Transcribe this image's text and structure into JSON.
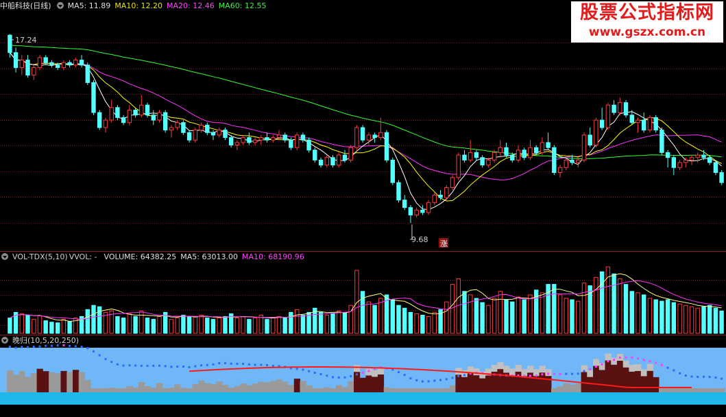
{
  "header": {
    "stock_name": "中船科技(日线)",
    "ma5_label": "MA5: 11.89",
    "ma10_label": "MA10: 12.20",
    "ma20_label": "MA20: 12.46",
    "ma60_label": "MA60: 12.55"
  },
  "annotations": {
    "high_label": "17.24",
    "low_label": "9.68",
    "rise_marker": "涨"
  },
  "volume_panel": {
    "indicator": "VOL-TDX(5,10)",
    "vvol": "VVOL: -",
    "volume_label": "VOLUME: 64382.25",
    "ma5_label": "MA5: 63013.00",
    "ma10_label": "MA10: 68190.96"
  },
  "indicator_panel": {
    "name": "晚归(10,5,20,250)"
  },
  "watermark": {
    "line1": "股票公式指标网",
    "line2": "www.gszx.com.cn"
  },
  "colors": {
    "up": "#ff3b3b",
    "down": "#54ffff",
    "ma5": "#ffffff",
    "ma10": "#ffff00",
    "ma20": "#ff33ff",
    "ma60": "#33ff33",
    "grid": "#8b1a1a",
    "indicator_bg": "#6fb7f7"
  },
  "chart_data": {
    "type": "candlestick",
    "price_range": [
      9.0,
      18.0
    ],
    "candles": [
      [
        17.2,
        17.24,
        16.3,
        16.5
      ],
      [
        16.5,
        16.7,
        15.7,
        15.9
      ],
      [
        15.9,
        16.4,
        15.6,
        16.2
      ],
      [
        16.2,
        16.4,
        15.5,
        15.6
      ],
      [
        15.6,
        16.0,
        15.4,
        15.9
      ],
      [
        15.9,
        16.4,
        15.8,
        16.3
      ],
      [
        16.3,
        16.4,
        16.0,
        16.1
      ],
      [
        16.1,
        16.2,
        15.9,
        16.0
      ],
      [
        16.0,
        16.1,
        15.8,
        15.9
      ],
      [
        15.9,
        16.2,
        15.8,
        16.1
      ],
      [
        16.1,
        16.2,
        15.9,
        16.0
      ],
      [
        16.0,
        16.3,
        15.9,
        16.2
      ],
      [
        16.2,
        16.4,
        15.9,
        16.0
      ],
      [
        16.0,
        16.1,
        15.2,
        15.3
      ],
      [
        15.3,
        15.4,
        14.0,
        14.1
      ],
      [
        14.1,
        14.2,
        13.4,
        13.5
      ],
      [
        13.5,
        13.9,
        13.3,
        13.8
      ],
      [
        13.8,
        14.6,
        13.7,
        14.3
      ],
      [
        14.3,
        14.4,
        13.8,
        13.9
      ],
      [
        13.9,
        14.0,
        13.6,
        13.7
      ],
      [
        13.7,
        14.4,
        13.6,
        14.2
      ],
      [
        14.2,
        14.3,
        13.9,
        14.0
      ],
      [
        14.0,
        14.8,
        13.9,
        14.4
      ],
      [
        14.4,
        14.5,
        13.9,
        14.0
      ],
      [
        14.0,
        14.2,
        13.6,
        13.8
      ],
      [
        13.8,
        14.2,
        13.7,
        14.1
      ],
      [
        14.1,
        14.2,
        13.3,
        13.4
      ],
      [
        13.4,
        13.6,
        13.1,
        13.5
      ],
      [
        13.5,
        13.8,
        13.4,
        13.7
      ],
      [
        13.7,
        13.8,
        13.2,
        13.3
      ],
      [
        13.3,
        13.4,
        12.9,
        13.0
      ],
      [
        13.0,
        13.5,
        12.9,
        13.4
      ],
      [
        13.4,
        13.7,
        13.3,
        13.6
      ],
      [
        13.6,
        13.7,
        13.2,
        13.3
      ],
      [
        13.3,
        13.4,
        13.0,
        13.2
      ],
      [
        13.2,
        13.5,
        13.1,
        13.4
      ],
      [
        13.4,
        13.5,
        13.0,
        13.1
      ],
      [
        13.1,
        13.2,
        12.7,
        12.8
      ],
      [
        12.8,
        13.0,
        12.6,
        12.9
      ],
      [
        12.9,
        13.2,
        12.8,
        13.1
      ],
      [
        13.1,
        13.3,
        12.8,
        12.9
      ],
      [
        12.9,
        13.1,
        12.8,
        13.0
      ],
      [
        13.0,
        13.2,
        12.8,
        13.1
      ],
      [
        13.1,
        13.3,
        12.9,
        13.0
      ],
      [
        13.0,
        13.2,
        12.9,
        13.1
      ],
      [
        13.1,
        13.4,
        13.0,
        13.2
      ],
      [
        13.2,
        13.3,
        12.9,
        13.0
      ],
      [
        13.0,
        13.1,
        12.6,
        12.7
      ],
      [
        12.7,
        13.3,
        12.6,
        13.2
      ],
      [
        13.2,
        13.3,
        12.9,
        13.0
      ],
      [
        13.0,
        13.1,
        12.5,
        12.6
      ],
      [
        12.6,
        12.7,
        12.1,
        12.2
      ],
      [
        12.2,
        12.3,
        11.9,
        12.0
      ],
      [
        12.0,
        12.4,
        11.9,
        12.3
      ],
      [
        12.3,
        12.4,
        11.9,
        12.0
      ],
      [
        12.0,
        12.5,
        11.9,
        12.4
      ],
      [
        12.4,
        12.6,
        12.1,
        12.2
      ],
      [
        12.2,
        12.8,
        12.1,
        12.7
      ],
      [
        12.7,
        13.6,
        12.6,
        13.5
      ],
      [
        13.5,
        13.6,
        12.9,
        13.0
      ],
      [
        13.0,
        13.3,
        12.8,
        13.2
      ],
      [
        13.2,
        13.3,
        12.9,
        13.1
      ],
      [
        13.1,
        13.9,
        13.0,
        13.3
      ],
      [
        13.3,
        13.4,
        12.1,
        12.2
      ],
      [
        12.2,
        12.3,
        11.2,
        11.3
      ],
      [
        11.3,
        11.4,
        10.5,
        10.6
      ],
      [
        10.6,
        10.8,
        10.2,
        10.3
      ],
      [
        10.3,
        10.4,
        9.68,
        10.0
      ],
      [
        10.0,
        10.3,
        9.9,
        10.2
      ],
      [
        10.2,
        10.4,
        10.0,
        10.1
      ],
      [
        10.1,
        10.6,
        10.0,
        10.5
      ],
      [
        10.5,
        10.9,
        10.4,
        10.8
      ],
      [
        10.8,
        11.0,
        10.6,
        10.7
      ],
      [
        10.7,
        11.2,
        10.6,
        11.1
      ],
      [
        11.1,
        11.6,
        11.0,
        11.5
      ],
      [
        11.5,
        12.5,
        11.4,
        12.4
      ],
      [
        12.4,
        12.6,
        12.1,
        12.2
      ],
      [
        12.2,
        13.0,
        12.1,
        12.5
      ],
      [
        12.5,
        12.6,
        12.2,
        12.3
      ],
      [
        12.3,
        12.4,
        11.9,
        12.0
      ],
      [
        12.0,
        12.3,
        11.9,
        12.2
      ],
      [
        12.2,
        12.6,
        12.1,
        12.5
      ],
      [
        12.5,
        13.0,
        12.3,
        12.7
      ],
      [
        12.7,
        12.9,
        12.3,
        12.4
      ],
      [
        12.4,
        12.5,
        12.1,
        12.2
      ],
      [
        12.2,
        12.8,
        12.1,
        12.6
      ],
      [
        12.6,
        12.7,
        12.2,
        12.3
      ],
      [
        12.3,
        13.0,
        12.2,
        12.7
      ],
      [
        12.7,
        12.8,
        12.4,
        12.5
      ],
      [
        12.5,
        13.1,
        12.4,
        12.9
      ],
      [
        12.9,
        13.3,
        12.6,
        12.7
      ],
      [
        12.7,
        12.8,
        11.6,
        11.7
      ],
      [
        11.7,
        12.0,
        11.5,
        11.9
      ],
      [
        11.9,
        12.3,
        11.8,
        12.2
      ],
      [
        12.2,
        12.4,
        12.0,
        12.1
      ],
      [
        12.1,
        12.3,
        11.9,
        12.2
      ],
      [
        12.2,
        13.3,
        12.1,
        13.2
      ],
      [
        13.2,
        13.5,
        12.7,
        12.8
      ],
      [
        12.8,
        13.9,
        12.7,
        13.8
      ],
      [
        13.8,
        14.3,
        13.4,
        13.5
      ],
      [
        13.5,
        14.5,
        13.4,
        14.4
      ],
      [
        14.4,
        14.6,
        14.0,
        14.1
      ],
      [
        14.1,
        14.7,
        14.0,
        14.5
      ],
      [
        14.5,
        14.6,
        13.9,
        14.0
      ],
      [
        14.0,
        14.2,
        13.6,
        13.7
      ],
      [
        13.7,
        13.9,
        13.3,
        13.8
      ],
      [
        13.8,
        14.1,
        13.3,
        13.4
      ],
      [
        13.4,
        14.0,
        13.3,
        13.9
      ],
      [
        13.9,
        14.0,
        13.3,
        13.4
      ],
      [
        13.4,
        13.5,
        12.4,
        12.5
      ],
      [
        12.5,
        12.6,
        11.9,
        12.3
      ],
      [
        12.3,
        12.4,
        11.6,
        11.9
      ],
      [
        11.9,
        12.2,
        11.8,
        12.1
      ],
      [
        12.1,
        12.3,
        11.9,
        12.2
      ],
      [
        12.2,
        12.4,
        12.0,
        12.3
      ],
      [
        12.3,
        12.5,
        12.1,
        12.4
      ],
      [
        12.4,
        12.6,
        12.2,
        12.3
      ],
      [
        12.3,
        12.4,
        12.0,
        12.1
      ],
      [
        12.1,
        12.2,
        11.6,
        11.7
      ],
      [
        11.7,
        11.8,
        11.2,
        11.3
      ]
    ],
    "volume": [
      22,
      30,
      28,
      26,
      20,
      25,
      18,
      16,
      15,
      20,
      17,
      22,
      24,
      34,
      40,
      38,
      30,
      32,
      24,
      22,
      28,
      24,
      32,
      22,
      20,
      24,
      30,
      20,
      22,
      26,
      24,
      24,
      26,
      22,
      20,
      22,
      24,
      28,
      22,
      24,
      20,
      22,
      26,
      20,
      22,
      24,
      22,
      30,
      34,
      26,
      30,
      36,
      30,
      26,
      28,
      32,
      30,
      40,
      90,
      60,
      45,
      40,
      50,
      55,
      48,
      40,
      36,
      30,
      28,
      26,
      24,
      30,
      34,
      45,
      70,
      78,
      60,
      55,
      50,
      44,
      40,
      50,
      60,
      48,
      45,
      52,
      48,
      55,
      62,
      58,
      70,
      70,
      55,
      50,
      48,
      46,
      72,
      68,
      80,
      88,
      95,
      85,
      78,
      70,
      60,
      58,
      55,
      50,
      48,
      46,
      48,
      44,
      42,
      40,
      38,
      36,
      38,
      40,
      36,
      32
    ],
    "volume_range": [
      0,
      100
    ]
  }
}
